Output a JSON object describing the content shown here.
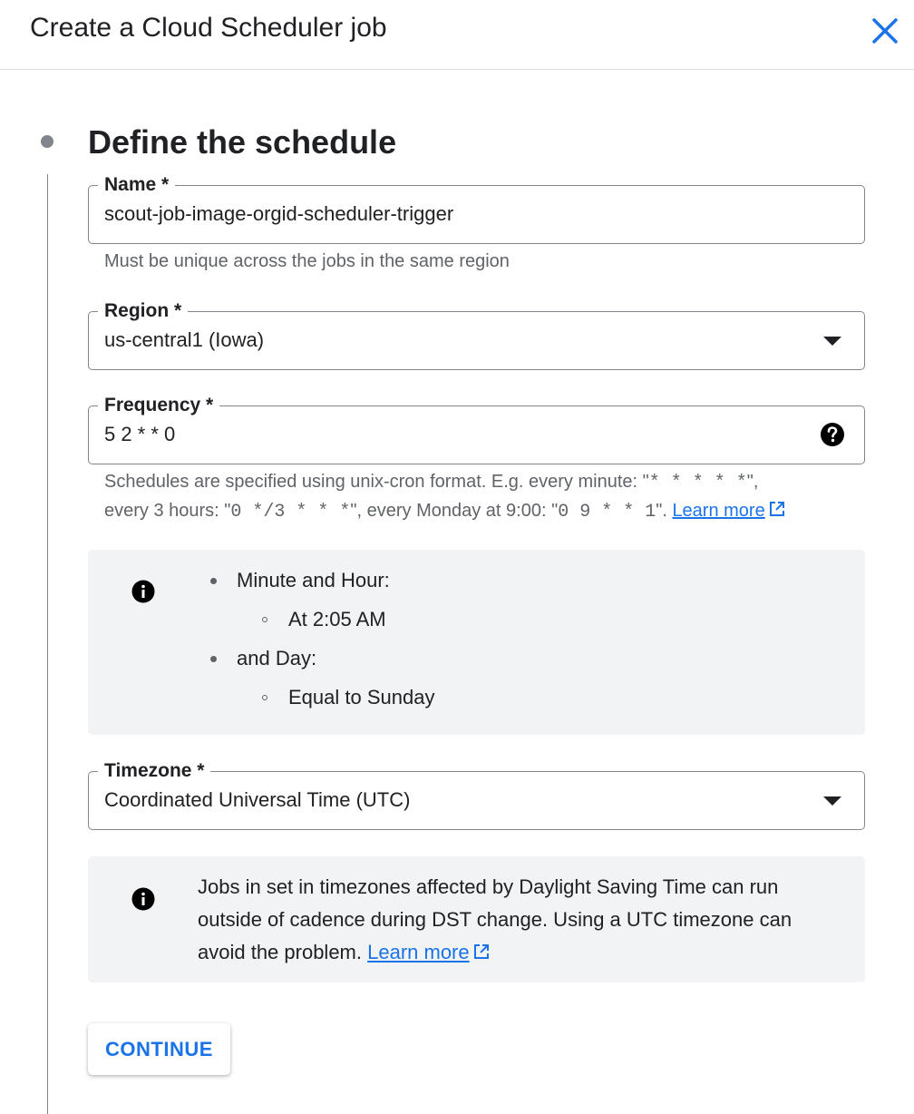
{
  "header": {
    "title": "Create a Cloud Scheduler job"
  },
  "step": {
    "title": "Define the schedule"
  },
  "name_field": {
    "label": "Name *",
    "value": "scout-job-image-orgid-scheduler-trigger",
    "hint": "Must be unique across the jobs in the same region"
  },
  "region_field": {
    "label": "Region *",
    "value": "us-central1 (Iowa)"
  },
  "frequency_field": {
    "label": "Frequency *",
    "value": "5 2 * * 0",
    "hint_part1": "Schedules are specified using unix-cron format. E.g. every minute: \"",
    "hint_code1": "* * * * *",
    "hint_part2": "\",",
    "hint_part3": "every 3 hours: \"",
    "hint_code2": "0 */3 * * *",
    "hint_part4": "\", every Monday at 9:00: \"",
    "hint_code3": "0 9 * * 1",
    "hint_part5": "\". ",
    "learn_more": "Learn more"
  },
  "schedule_info": {
    "items": [
      {
        "label": "Minute and Hour:",
        "sub": "At 2:05 AM"
      },
      {
        "label": "and Day:",
        "sub": "Equal to Sunday"
      }
    ]
  },
  "timezone_field": {
    "label": "Timezone *",
    "value": "Coordinated Universal Time (UTC)"
  },
  "dst_info": {
    "text": "Jobs in set in timezones affected by Daylight Saving Time can run outside of cadence during DST change. Using a UTC timezone can avoid the problem. ",
    "learn_more": "Learn more"
  },
  "continue_button": {
    "label": "CONTINUE"
  },
  "colors": {
    "accent": "#1a73e8",
    "text": "#202124",
    "secondary_text": "#5f6368",
    "border": "#80868b",
    "info_bg": "#f1f3f4"
  },
  "icons": {
    "close": "close-icon",
    "help": "help-icon",
    "info": "info-icon",
    "external_link": "external-link-icon",
    "dropdown": "dropdown-arrow-icon"
  }
}
